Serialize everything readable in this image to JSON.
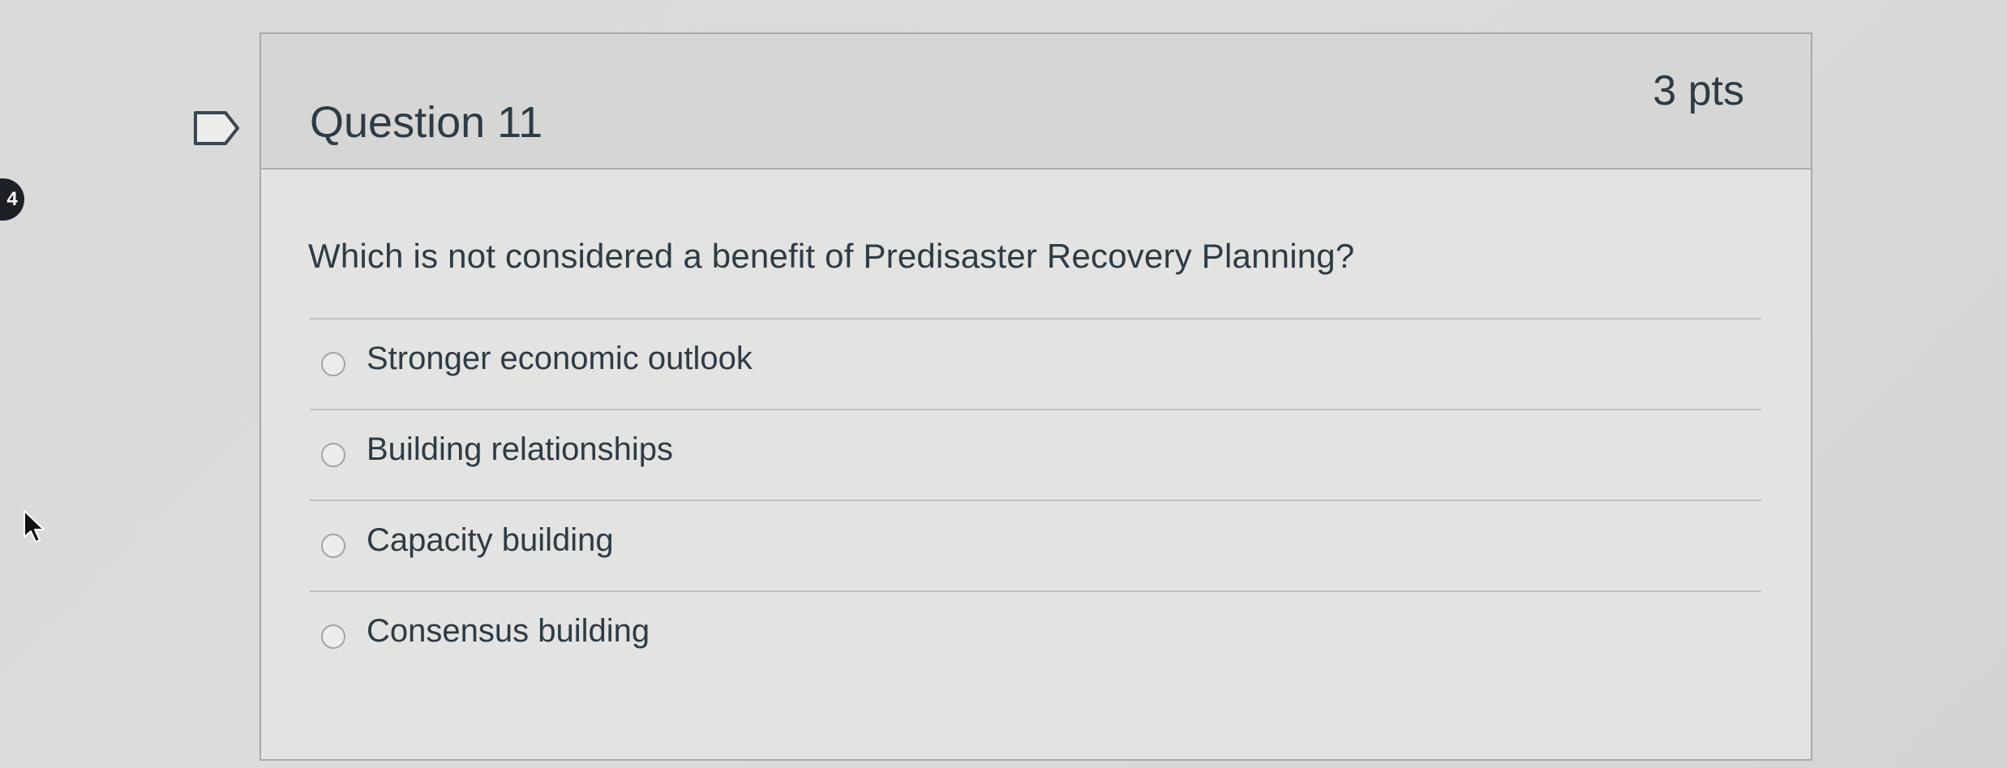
{
  "sidebar": {
    "badge_text": "4"
  },
  "question": {
    "title": "Question 11",
    "points": "3 pts",
    "prompt": "Which is not considered a benefit of Predisaster Recovery Planning?"
  },
  "answers": [
    {
      "label": "Stronger economic outlook"
    },
    {
      "label": "Building relationships"
    },
    {
      "label": "Capacity building"
    },
    {
      "label": "Consensus building"
    }
  ],
  "icons": {
    "flag": "flag-outline-icon",
    "cursor": "mouse-pointer-icon",
    "radio": "radio-unselected-icon"
  },
  "colors": {
    "text": "#2d3b45",
    "header_bg": "#d6d6d4",
    "card_bg": "#e3e3e1",
    "border": "#a9aaa9",
    "badge_bg": "#1d2126"
  }
}
